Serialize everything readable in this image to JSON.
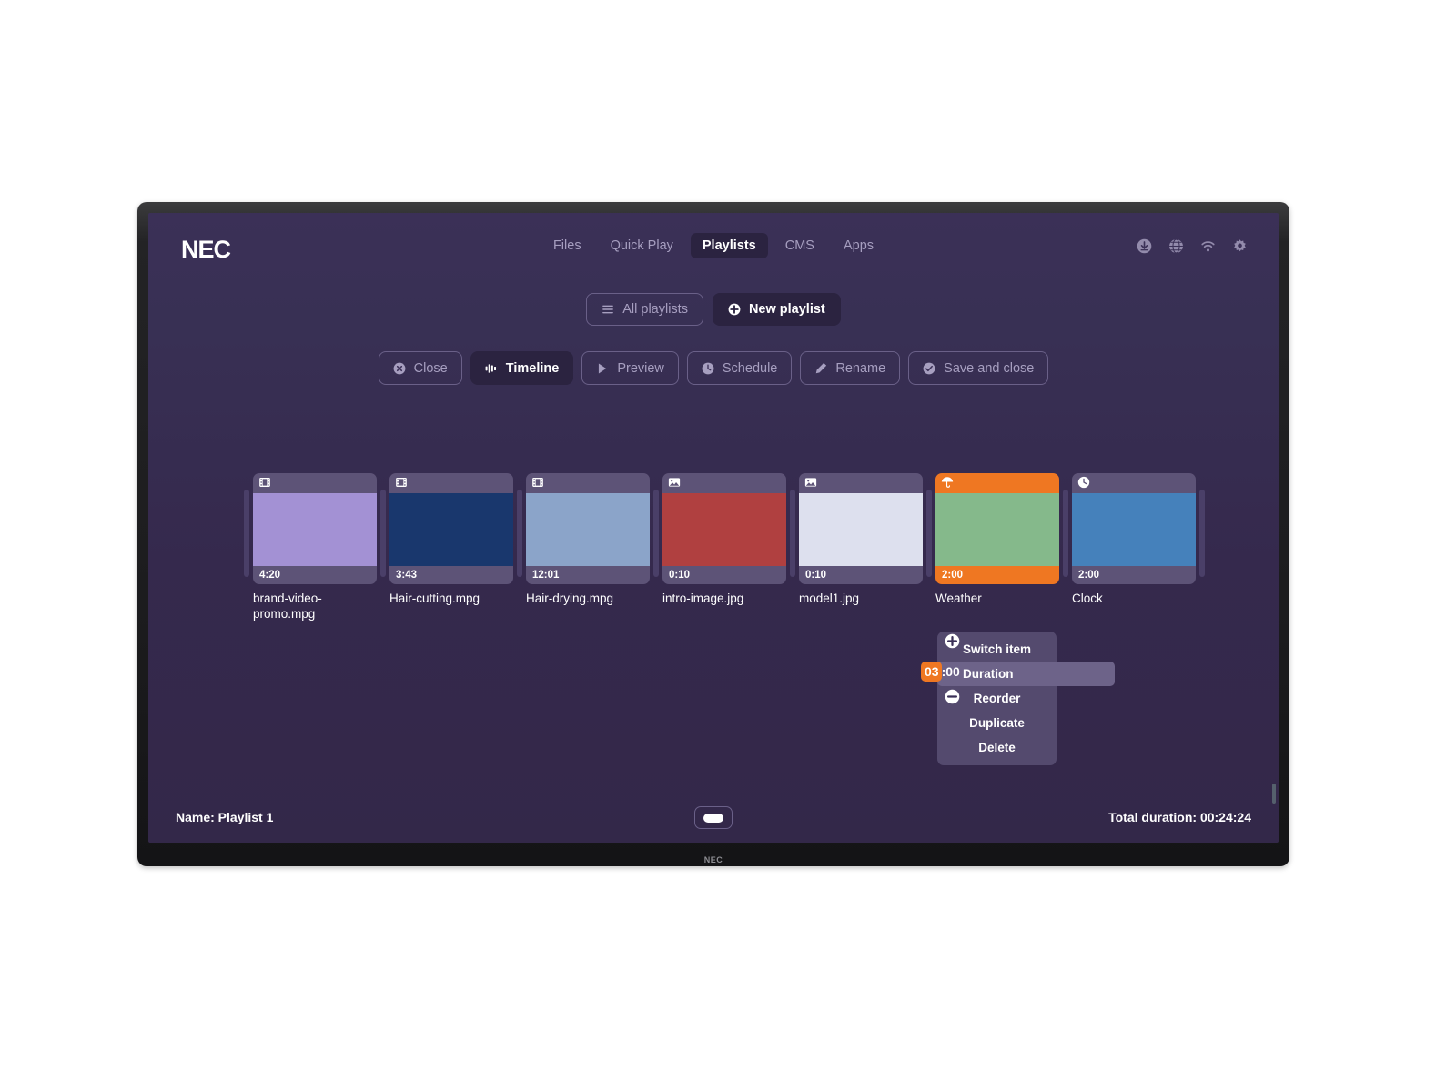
{
  "brand": {
    "logo": "NEC",
    "bezel_logo": "NEC"
  },
  "nav": {
    "items": [
      {
        "label": "Files",
        "active": false
      },
      {
        "label": "Quick Play",
        "active": false
      },
      {
        "label": "Playlists",
        "active": true
      },
      {
        "label": "CMS",
        "active": false
      },
      {
        "label": "Apps",
        "active": false
      }
    ],
    "system_icons": [
      "download-icon",
      "globe-icon",
      "wifi-icon",
      "gear-icon"
    ]
  },
  "playlist_bar": {
    "all_playlists": "All playlists",
    "new_playlist": "New playlist"
  },
  "toolbar": {
    "close": "Close",
    "timeline": "Timeline",
    "preview": "Preview",
    "schedule": "Schedule",
    "rename": "Rename",
    "save_and_close": "Save and close"
  },
  "timeline": {
    "items": [
      {
        "label": "brand-video-promo.mpg",
        "duration": "4:20",
        "type": "video",
        "icon": "film-icon",
        "thumb_color": "#a391d4",
        "selected": false
      },
      {
        "label": "Hair-cutting.mpg",
        "duration": "3:43",
        "type": "video",
        "icon": "film-icon",
        "thumb_color": "#19376d",
        "selected": false
      },
      {
        "label": "Hair-drying.mpg",
        "duration": "12:01",
        "type": "video",
        "icon": "film-icon",
        "thumb_color": "#8ba4c9",
        "selected": false
      },
      {
        "label": "intro-image.jpg",
        "duration": "0:10",
        "type": "image",
        "icon": "image-icon",
        "thumb_color": "#b04040",
        "selected": false
      },
      {
        "label": "model1.jpg",
        "duration": "0:10",
        "type": "image",
        "icon": "image-icon",
        "thumb_color": "#dde0ee",
        "selected": false
      },
      {
        "label": "Weather",
        "duration": "2:00",
        "type": "widget",
        "icon": "umbrella-icon",
        "thumb_color": "#85b98b",
        "selected": true
      },
      {
        "label": "Clock",
        "duration": "2:00",
        "type": "widget",
        "icon": "clock-icon",
        "thumb_color": "#4581bb",
        "selected": false
      }
    ]
  },
  "context_menu": {
    "items": [
      {
        "label": "Switch item",
        "highlighted": false
      },
      {
        "label": "Duration",
        "highlighted": true
      },
      {
        "label": "Reorder",
        "highlighted": false
      },
      {
        "label": "Duplicate",
        "highlighted": false
      },
      {
        "label": "Delete",
        "highlighted": false
      }
    ],
    "duration_hours": "03",
    "duration_minutes": ":00",
    "increment_icon": "plus-circle-icon",
    "decrement_icon": "minus-circle-icon"
  },
  "status": {
    "name": "Name: Playlist 1",
    "total_duration": "Total duration: 00:24:24"
  },
  "colors": {
    "screen_bg_top": "#3b3057",
    "screen_bg_bottom": "#332849",
    "accent_orange": "#ef7722",
    "muted_text": "#a79fc0",
    "card_chrome": "#5d5377",
    "active_chip": "#2b2340"
  }
}
